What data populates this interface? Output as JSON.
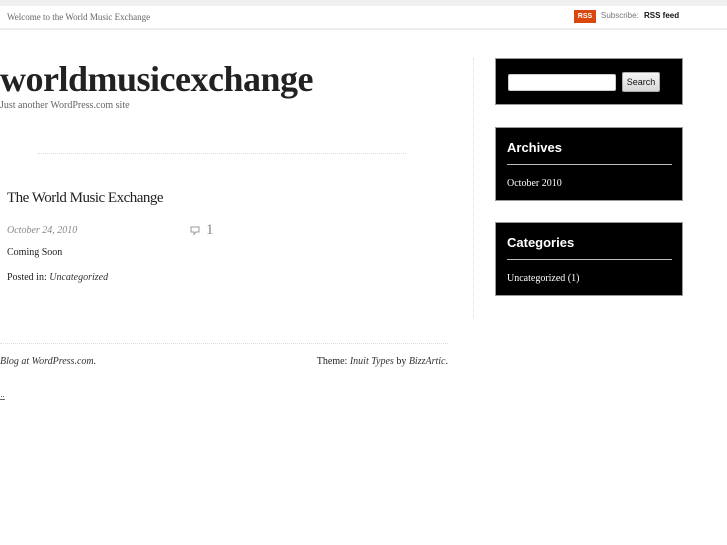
{
  "topbar": {
    "welcome": "Welcome to the World Music Exchange",
    "rss_badge": "RSS",
    "subscribe_label": "Subscribe:",
    "rss_link": "RSS feed",
    "rss_color": "#d9480f"
  },
  "header": {
    "site_title": "worldmusicexchange",
    "tagline": "Just another WordPress.com site"
  },
  "post": {
    "title": "The World Music Exchange",
    "date": "October 24, 2010",
    "comment_icon": "comment-bubble-icon",
    "comment_count": "1",
    "body": "Coming Soon",
    "posted_in_label": "Posted in:",
    "category": "Uncategorized"
  },
  "footer": {
    "blog_link": "Blog at WordPress.com.",
    "theme_label": "Theme:",
    "theme_name": "Inuit Types",
    "by_label": "by",
    "author": "BizzArtic",
    "period": "."
  },
  "sidebar": {
    "search": {
      "value": "",
      "placeholder": "",
      "button_label": "Search"
    },
    "archives": {
      "title": "Archives",
      "items": [
        "October 2010"
      ]
    },
    "categories": {
      "title": "Categories",
      "items": [
        "Uncategorized (1)"
      ]
    }
  }
}
